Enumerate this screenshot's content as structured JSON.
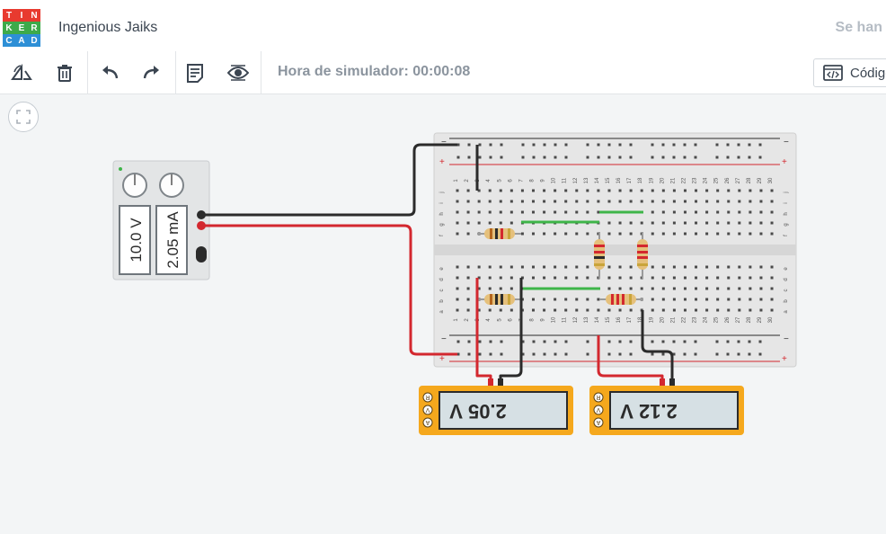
{
  "app": {
    "logo_letters": [
      "T",
      "I",
      "N",
      "K",
      "E",
      "R",
      "C",
      "A",
      "D"
    ],
    "logo_colors": [
      "#e83a2f",
      "#e83a2f",
      "#e83a2f",
      "#3daa4a",
      "#3daa4a",
      "#3daa4a",
      "#2d8fd6",
      "#2d8fd6",
      "#2d8fd6"
    ],
    "design_name": "Ingenious Jaiks",
    "save_status": "Se han"
  },
  "toolbar": {
    "tools": [
      {
        "icon": "rotate-icon",
        "label": "Girar"
      },
      {
        "icon": "trash-icon",
        "label": "Eliminar"
      },
      {
        "icon": "undo-icon",
        "label": "Deshacer"
      },
      {
        "icon": "redo-icon",
        "label": "Rehacer"
      },
      {
        "icon": "notes-icon",
        "label": "Notas"
      },
      {
        "icon": "eye-icon",
        "label": "Mostrar"
      }
    ],
    "sim_time": "Hora de simulador: 00:00:08",
    "code_label": "Código"
  },
  "canvas": {
    "fit_icon": "fit-view-icon",
    "power_supply": {
      "voltage": "10.0 V",
      "current": "2.05 mA"
    },
    "breadboard": {
      "col_numbers": [
        "1",
        "2",
        "3",
        "4",
        "5",
        "6",
        "7",
        "8",
        "9",
        "10",
        "11",
        "12",
        "13",
        "14",
        "15",
        "16",
        "17",
        "18",
        "19",
        "20",
        "21",
        "22",
        "23",
        "24",
        "25",
        "26",
        "27",
        "28",
        "29",
        "30"
      ],
      "top_rows": [
        "j",
        "i",
        "h",
        "g",
        "f"
      ],
      "bottom_rows": [
        "e",
        "d",
        "c",
        "b",
        "a"
      ],
      "rail_minus": "−",
      "rail_plus": "+"
    },
    "multimeters": [
      {
        "reading": "2.05 V",
        "modes": [
          "R",
          "V",
          "A"
        ]
      },
      {
        "reading": "2.12 V",
        "modes": [
          "R",
          "V",
          "A"
        ]
      }
    ],
    "colors": {
      "wire_black": "#2b2b2b",
      "wire_red": "#d3282f",
      "wire_green": "#3eb549",
      "meter_body": "#f5a81d",
      "lcd": "#d6e0e4"
    }
  }
}
